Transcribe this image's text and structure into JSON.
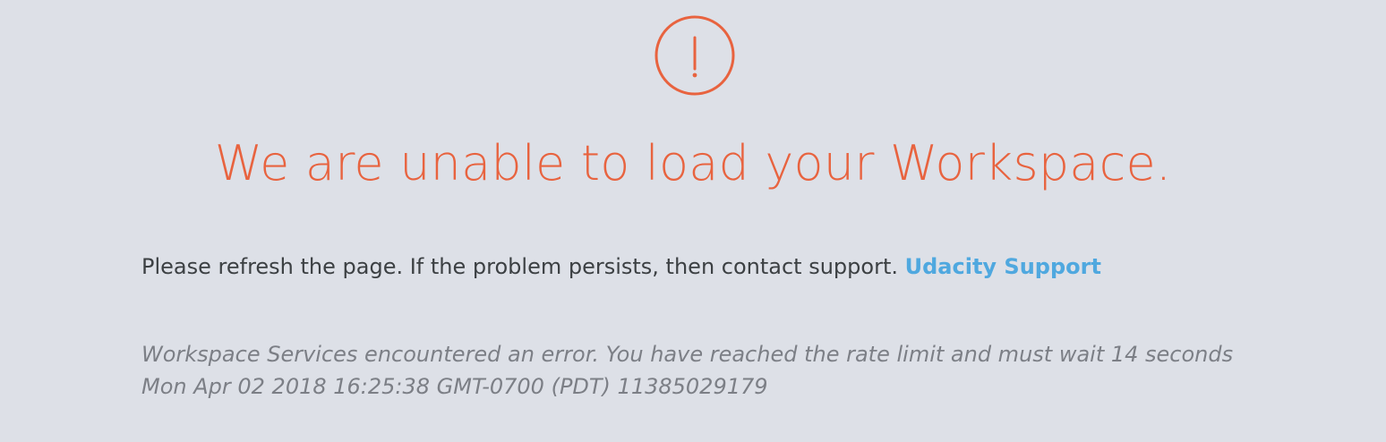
{
  "error": {
    "icon": "exclamation-circle-icon",
    "icon_color": "#e8633f",
    "headline": "We are unable to load your Workspace.",
    "message": "Please refresh the page. If the problem persists, then contact support.",
    "support_link_label": "Udacity Support",
    "details": [
      "Workspace Services encountered an error. You have reached the rate limit and must wait 14 seconds",
      "Mon Apr 02 2018 16:25:38 GMT-0700 (PDT) 11385029179"
    ]
  },
  "colors": {
    "background": "#dde0e7",
    "accent": "#e8633f",
    "link": "#4fa8df",
    "body_text": "#3c4043",
    "muted_text": "#7c7f86"
  }
}
